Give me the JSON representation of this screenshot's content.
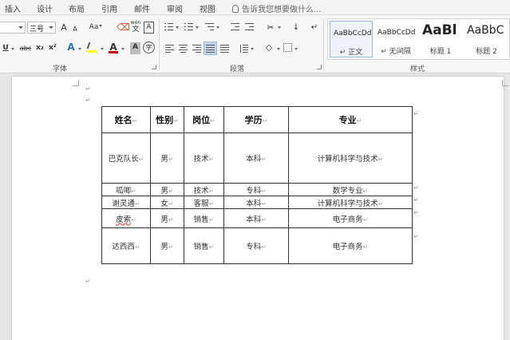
{
  "menu": {
    "items": [
      "插入",
      "设计",
      "布局",
      "引用",
      "邮件",
      "审阅",
      "视图"
    ],
    "tell_me": "告诉我您想要做什么..."
  },
  "ribbon": {
    "font": {
      "label": "字体",
      "font_name_value": "",
      "font_size_value": "三号",
      "grow": "A",
      "shrink": "A",
      "change_case": "Aa",
      "phonetic_top": "wén",
      "phonetic_bottom": "文",
      "char_border": "A",
      "underline": "U",
      "strikethrough": "abc",
      "subscript": "x₂",
      "superscript": "x²",
      "text_effect": "A",
      "font_color": "A",
      "char_shading": "A",
      "enclose": "字"
    },
    "paragraph": {
      "label": "段落"
    },
    "styles": {
      "label": "样式",
      "items": [
        {
          "sample": "AaBbCcDd",
          "name": "↵ 正文"
        },
        {
          "sample": "AaBbCcDd",
          "name": "↵ 无间隔"
        },
        {
          "sample": "AaBl",
          "name": "标题 1"
        },
        {
          "sample": "AaBbC",
          "name": "标题 2"
        }
      ]
    },
    "colors": {
      "accent": "#c5d6ea",
      "font_color": "#c00000",
      "highlight": "#ffff00"
    }
  },
  "document": {
    "paragraph_mark": "↵",
    "table": {
      "headers": [
        "姓名",
        "性别",
        "岗位",
        "学历",
        "专业"
      ],
      "rows": [
        [
          "巴克队长",
          "男",
          "技术",
          "本科",
          "计算机科学与技术"
        ],
        [
          "呱唧",
          "男",
          "技术",
          "专科",
          "数学专业"
        ],
        [
          "谢灵通",
          "女",
          "客服",
          "本科",
          "计算机科学与技术"
        ],
        [
          "皮索",
          "男",
          "销售",
          "本科",
          "电子商务"
        ],
        [
          "达西西",
          "男",
          "销售",
          "专科",
          "电子商务"
        ]
      ]
    }
  }
}
